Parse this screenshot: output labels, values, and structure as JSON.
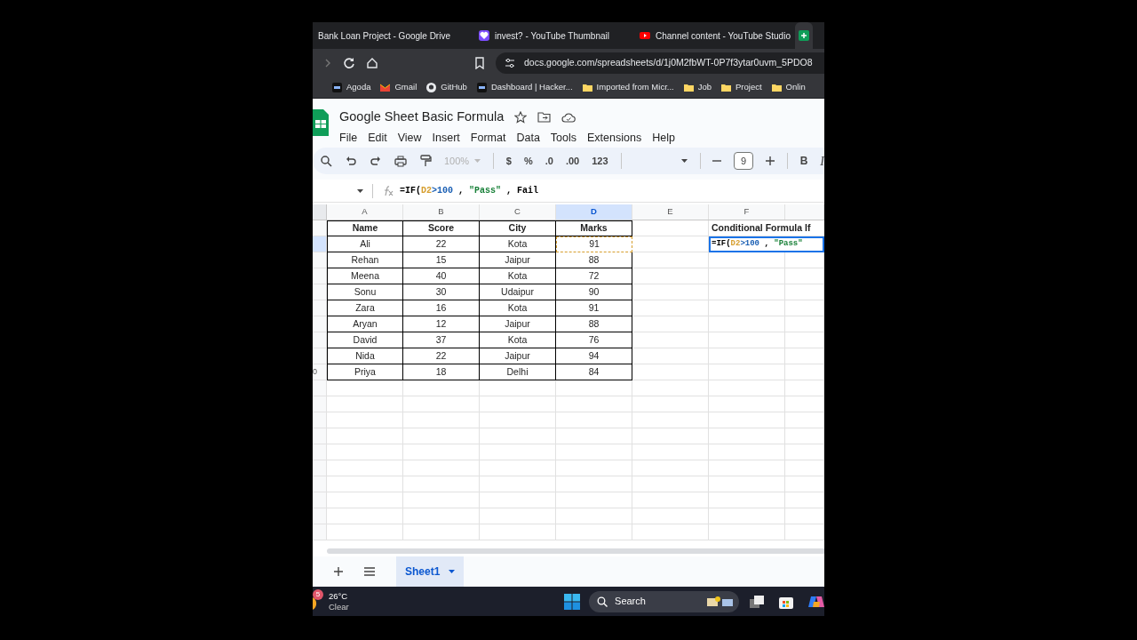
{
  "browser": {
    "tabs": [
      {
        "title": "Bank Loan Project - Google Drive",
        "kind": "drive",
        "selected": false
      },
      {
        "title": "invest? - YouTube Thumbnail",
        "kind": "heart",
        "selected": false
      },
      {
        "title": "Channel content - YouTube Studio",
        "kind": "youtube",
        "selected": false
      },
      {
        "kind": "sheets",
        "selected": true
      }
    ],
    "url": "docs.google.com/spreadsheets/d/1j0M2fbWT-0P7f3ytar0uvm_5PDO8",
    "bookmarks": [
      {
        "label": "Agoda",
        "kind": "site"
      },
      {
        "label": "Gmail",
        "kind": "mail"
      },
      {
        "label": "GitHub",
        "kind": "github"
      },
      {
        "label": "Dashboard | Hacker...",
        "kind": "site"
      },
      {
        "label": "Imported from Micr...",
        "kind": "folder"
      },
      {
        "label": "Job",
        "kind": "folder"
      },
      {
        "label": "Project",
        "kind": "folder"
      },
      {
        "label": "Onlin",
        "kind": "folder"
      }
    ]
  },
  "document": {
    "title": "Google Sheet Basic Formula",
    "menu": [
      "File",
      "Edit",
      "View",
      "Insert",
      "Format",
      "Data",
      "Tools",
      "Extensions",
      "Help"
    ]
  },
  "toolbar": {
    "zoom": "100%",
    "currency": "$",
    "percent": "%",
    "decrease_decimals": ".0",
    "increase_decimals": ".00",
    "number_format": "123",
    "font_size": "9",
    "bold": "B",
    "italic": "I"
  },
  "formula_bar": {
    "tokens": [
      {
        "text": "=IF("
      },
      {
        "text": "D2",
        "color": "#d69e2e"
      },
      {
        "text": ">100",
        "color": "#1a5fb4"
      },
      {
        "text": " , "
      },
      {
        "text": "\"Pass\"",
        "color": "#188038"
      },
      {
        "text": " , Fail"
      }
    ]
  },
  "sheet": {
    "columns": [
      {
        "label": "A",
        "selected": false
      },
      {
        "label": "B",
        "selected": false
      },
      {
        "label": "C",
        "selected": false
      },
      {
        "label": "D",
        "selected": true
      },
      {
        "label": "E",
        "selected": false
      },
      {
        "label": "F",
        "selected": false
      }
    ],
    "table_header": [
      "Name",
      "Score",
      "City",
      "Marks"
    ],
    "rows": [
      [
        "Ali",
        "22",
        "Kota",
        "91"
      ],
      [
        "Rehan",
        "15",
        "Jaipur",
        "88"
      ],
      [
        "Meena",
        "40",
        "Kota",
        "72"
      ],
      [
        "Sonu",
        "30",
        "Udaipur",
        "90"
      ],
      [
        "Zara",
        "16",
        "Kota",
        "91"
      ],
      [
        "Aryan",
        "12",
        "Jaipur",
        "88"
      ],
      [
        "David",
        "37",
        "Kota",
        "76"
      ],
      [
        "Nida",
        "22",
        "Jaipur",
        "94"
      ],
      [
        "Priya",
        "18",
        "Delhi",
        "84"
      ]
    ],
    "f1": "Conditional Formula If",
    "f2_tokens": [
      {
        "text": "=IF("
      },
      {
        "text": "D2",
        "color": "#d69e2e"
      },
      {
        "text": ">100",
        "color": "#1a5fb4"
      },
      {
        "text": " , "
      },
      {
        "text": "\"Pass\"",
        "color": "#188038"
      }
    ],
    "row_label_fragment": "0"
  },
  "sheet_tabs": [
    {
      "label": "Sheet1",
      "selected": true
    }
  ],
  "taskbar": {
    "notification_count": "5",
    "temperature": "26°C",
    "weather": "Clear",
    "search": "Search"
  }
}
